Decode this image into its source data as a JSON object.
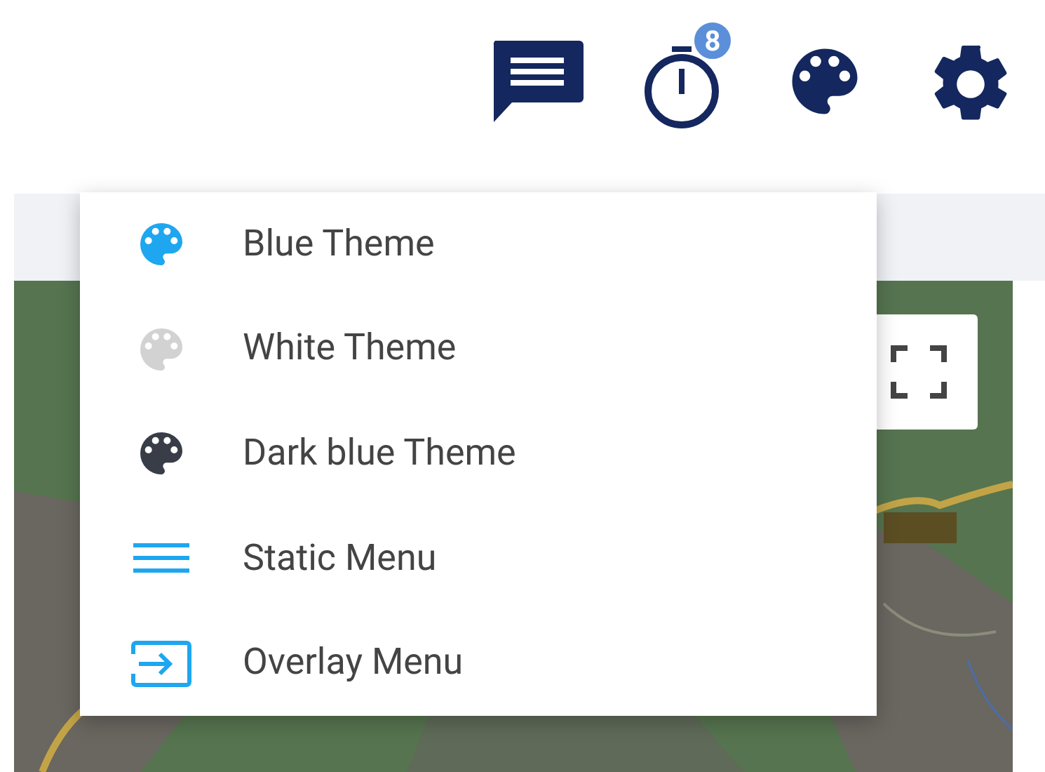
{
  "toolbar": {
    "timer_badge": "8"
  },
  "menu": {
    "items": [
      {
        "kind": "theme",
        "label": "Blue Theme",
        "color": "#1ea7f0"
      },
      {
        "kind": "theme",
        "label": "White Theme",
        "color": "#d2d2d2"
      },
      {
        "kind": "theme",
        "label": "Dark blue Theme",
        "color": "#383d47"
      },
      {
        "kind": "static",
        "label": "Static Menu"
      },
      {
        "kind": "overlay",
        "label": "Overlay Menu"
      }
    ]
  }
}
